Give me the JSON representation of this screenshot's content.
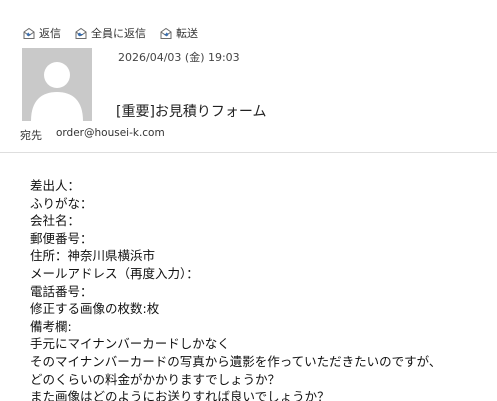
{
  "toolbar": {
    "reply": {
      "label": "返信",
      "icon": "reply-icon"
    },
    "reply_all": {
      "label": "全員に返信",
      "icon": "reply-all-icon"
    },
    "forward": {
      "label": "転送",
      "icon": "forward-icon"
    }
  },
  "message": {
    "date": "2026/04/03 (金) 19:03",
    "subject": "[重要]お見積りフォーム",
    "to_label": "宛先",
    "to_address": "order@housei-k.com"
  },
  "body_lines": [
    "差出人：",
    "ふりがな：",
    "会社名：",
    "郵便番号：",
    "住所：神奈川県横浜市",
    "メールアドレス（再度入力）：",
    "電話番号：",
    "修正する画像の枚数:枚",
    "備考欄:",
    "手元にマイナンバーカードしかなく",
    "そのマイナンバーカードの写真から遺影を作っていただきたいのですが、",
    "どのくらいの料金がかかりますでしょうか？",
    "また画像はどのようにお送りすれば良いでしょうか？"
  ],
  "colors": {
    "avatar_bg": "#c9c9c9",
    "avatar_fg": "#ffffff",
    "icon_accent": "#3a6fb0",
    "icon_gray": "#6b6b6b",
    "divider": "#dedede"
  }
}
